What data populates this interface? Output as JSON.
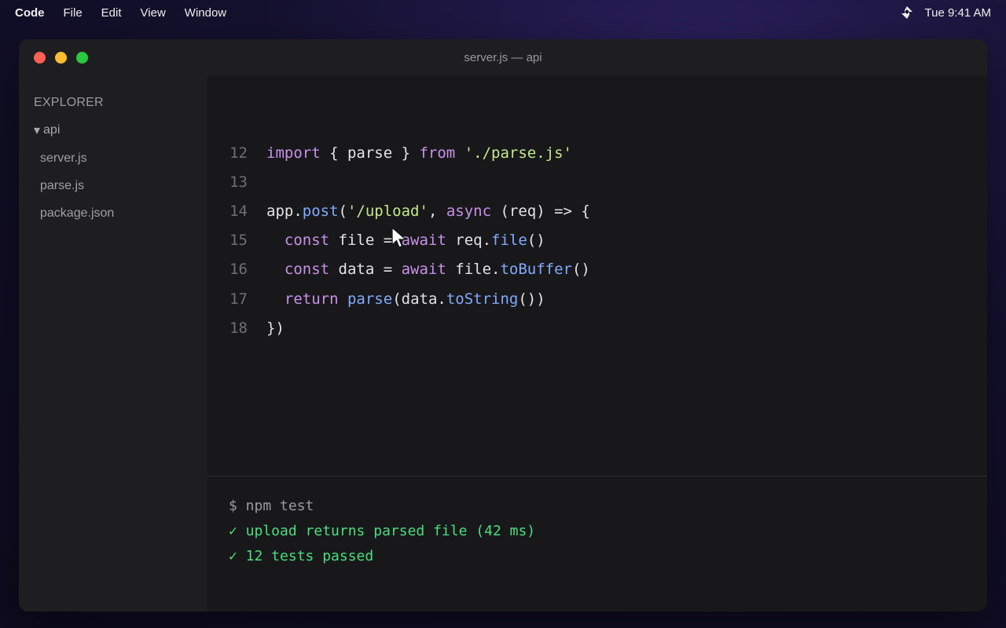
{
  "menubar": {
    "app_name": "Code",
    "menus": [
      "File",
      "Edit",
      "View",
      "Window"
    ],
    "status_icon": "sync-icon",
    "clock": "Tue 9:41 AM"
  },
  "window": {
    "title": "server.js — api"
  },
  "sidebar": {
    "header": "EXPLORER",
    "folder": "api",
    "folder_arrow": "▾",
    "files": [
      "server.js",
      "parse.js",
      "package.json"
    ]
  },
  "editor": {
    "lines": [
      {
        "n": "12",
        "tokens": [
          [
            "kw",
            "import"
          ],
          [
            "plain",
            " { parse } "
          ],
          [
            "kw",
            "from"
          ],
          [
            "plain",
            " "
          ],
          [
            "str",
            "'./parse.js'"
          ]
        ]
      },
      {
        "n": "13",
        "tokens": []
      },
      {
        "n": "14",
        "tokens": [
          [
            "plain",
            "app."
          ],
          [
            "fn",
            "post"
          ],
          [
            "plain",
            "("
          ],
          [
            "str",
            "'/upload'"
          ],
          [
            "plain",
            ", "
          ],
          [
            "kw",
            "async"
          ],
          [
            "plain",
            " (req) => {"
          ]
        ]
      },
      {
        "n": "15",
        "tokens": [
          [
            "plain",
            "  "
          ],
          [
            "kw",
            "const"
          ],
          [
            "plain",
            " file = "
          ],
          [
            "kw",
            "await"
          ],
          [
            "plain",
            " req."
          ],
          [
            "fn",
            "file"
          ],
          [
            "plain",
            "()"
          ]
        ]
      },
      {
        "n": "16",
        "tokens": [
          [
            "plain",
            "  "
          ],
          [
            "kw",
            "const"
          ],
          [
            "plain",
            " data = "
          ],
          [
            "kw",
            "await"
          ],
          [
            "plain",
            " file."
          ],
          [
            "fn",
            "toBuffer"
          ],
          [
            "plain",
            "()"
          ]
        ]
      },
      {
        "n": "17",
        "tokens": [
          [
            "plain",
            "  "
          ],
          [
            "kw",
            "return"
          ],
          [
            "plain",
            " "
          ],
          [
            "fn",
            "parse"
          ],
          [
            "plain",
            "(data."
          ],
          [
            "fn",
            "toString"
          ],
          [
            "plain",
            "())"
          ]
        ]
      },
      {
        "n": "18",
        "tokens": [
          [
            "plain",
            "})"
          ]
        ]
      }
    ]
  },
  "terminal": {
    "command": "$ npm test",
    "results": [
      "✓ upload returns parsed file (42 ms)",
      "✓ 12 tests passed"
    ]
  },
  "colors": {
    "keyword": "#c792ea",
    "string": "#c3e88d",
    "function": "#82aaff",
    "success": "#4ade80"
  }
}
